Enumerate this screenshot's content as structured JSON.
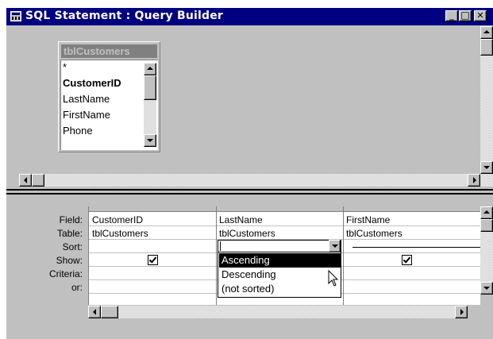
{
  "window": {
    "title": "SQL Statement : Query Builder",
    "buttons": {
      "minimize": "_",
      "maximize": "□",
      "close": "✕"
    }
  },
  "field_list": {
    "title": "tblCustomers",
    "fields": [
      "*",
      "CustomerID",
      "LastName",
      "FirstName",
      "Phone"
    ]
  },
  "grid": {
    "row_labels": [
      "Field:",
      "Table:",
      "Sort:",
      "Show:",
      "Criteria:",
      "or:"
    ],
    "columns": [
      {
        "field": "CustomerID",
        "table": "tblCustomers",
        "show": true
      },
      {
        "field": "LastName",
        "table": "tblCustomers",
        "show": true
      },
      {
        "field": "FirstName",
        "table": "tblCustomers",
        "show": true
      }
    ]
  },
  "sort_dropdown": {
    "options": [
      "Ascending",
      "Descending",
      "(not sorted)"
    ],
    "highlighted": "Ascending"
  },
  "icons": [
    "table-icon",
    "mouse-pointer-icon",
    "checkbox-checked-icon"
  ]
}
